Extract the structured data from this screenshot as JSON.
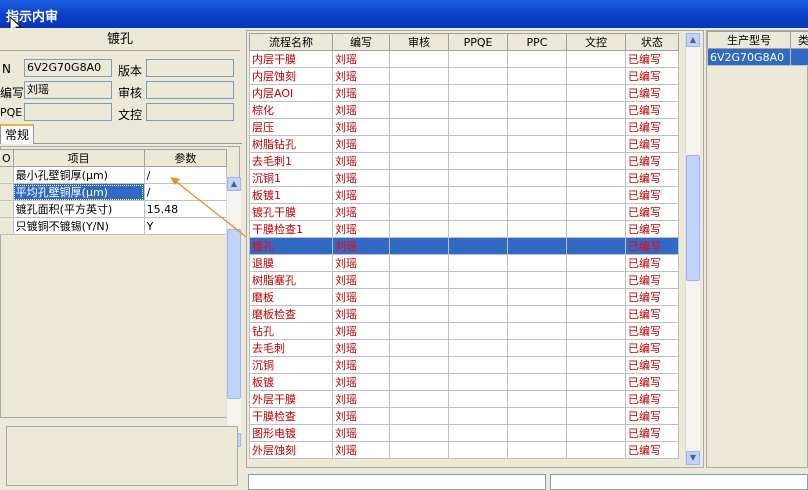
{
  "window": {
    "title": "指示内审"
  },
  "left": {
    "header": "镀孔",
    "fields": [
      {
        "label": "N",
        "value": "6V2G70G8A0",
        "label2": "版本",
        "value2": ""
      },
      {
        "label": "编写",
        "value": "刘瑶",
        "label2": "审核",
        "value2": ""
      },
      {
        "label": "PQE",
        "value": "",
        "label2": "文控",
        "value2": ""
      }
    ],
    "tab": "常规",
    "param_table": {
      "headers": [
        "O",
        "项目",
        "参数"
      ],
      "rows": [
        {
          "item": "最小孔壁铜厚(μm)",
          "value": "/"
        },
        {
          "item": "平均孔壁铜厚(μm)",
          "value": "/"
        },
        {
          "item": "镀孔面积(平方英寸)",
          "value": "15.48"
        },
        {
          "item": "只镀铜不镀锡(Y/N)",
          "value": "Y"
        }
      ]
    }
  },
  "middle": {
    "headers": [
      "流程名称",
      "编写",
      "审核",
      "PPQE",
      "PPC",
      "文控",
      "状态"
    ],
    "rows": [
      {
        "name": "内层干膜",
        "writer": "刘瑶",
        "status": "已编写"
      },
      {
        "name": "内层蚀刻",
        "writer": "刘瑶",
        "status": "已编写"
      },
      {
        "name": "内层AOI",
        "writer": "刘瑶",
        "status": "已编写"
      },
      {
        "name": "棕化",
        "writer": "刘瑶",
        "status": "已编写"
      },
      {
        "name": "层压",
        "writer": "刘瑶",
        "status": "已编写"
      },
      {
        "name": "树脂钻孔",
        "writer": "刘瑶",
        "status": "已编写"
      },
      {
        "name": "去毛刺1",
        "writer": "刘瑶",
        "status": "已编写"
      },
      {
        "name": "沉铜1",
        "writer": "刘瑶",
        "status": "已编写"
      },
      {
        "name": "板镀1",
        "writer": "刘瑶",
        "status": "已编写"
      },
      {
        "name": "镀孔干膜",
        "writer": "刘瑶",
        "status": "已编写"
      },
      {
        "name": "干膜检查1",
        "writer": "刘瑶",
        "status": "已编写"
      },
      {
        "name": "镀孔",
        "writer": "刘瑶",
        "status": "已编写"
      },
      {
        "name": "退膜",
        "writer": "刘瑶",
        "status": "已编写"
      },
      {
        "name": "树脂塞孔",
        "writer": "刘瑶",
        "status": "已编写"
      },
      {
        "name": "磨板",
        "writer": "刘瑶",
        "status": "已编写"
      },
      {
        "name": "磨板检查",
        "writer": "刘瑶",
        "status": "已编写"
      },
      {
        "name": "钻孔",
        "writer": "刘瑶",
        "status": "已编写"
      },
      {
        "name": "去毛刺",
        "writer": "刘瑶",
        "status": "已编写"
      },
      {
        "name": "沉铜",
        "writer": "刘瑶",
        "status": "已编写"
      },
      {
        "name": "板镀",
        "writer": "刘瑶",
        "status": "已编写"
      },
      {
        "name": "外层干膜",
        "writer": "刘瑶",
        "status": "已编写"
      },
      {
        "name": "干膜检查",
        "writer": "刘瑶",
        "status": "已编写"
      },
      {
        "name": "图形电镀",
        "writer": "刘瑶",
        "status": "已编写"
      },
      {
        "name": "外层蚀刻",
        "writer": "刘瑶",
        "status": "已编写"
      }
    ],
    "selected_index": 11
  },
  "right": {
    "headers": [
      "生产型号",
      "类"
    ],
    "rows": [
      {
        "model": "6V2G70G8A0",
        "type": ""
      }
    ]
  },
  "colors": {
    "titlebar": "#0a3fc8",
    "selection": "#316ac5",
    "red_text": "#c00000"
  }
}
